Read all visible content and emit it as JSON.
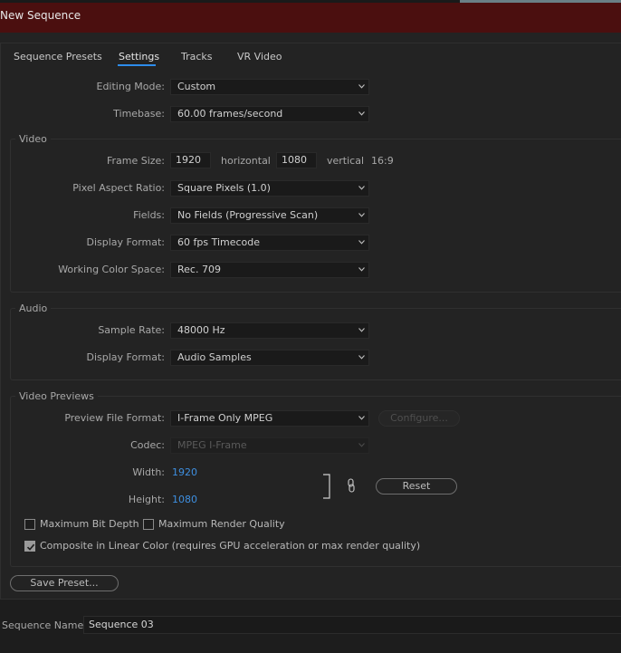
{
  "window": {
    "title": "New Sequence"
  },
  "tabs": [
    {
      "label": "Sequence Presets"
    },
    {
      "label": "Settings"
    },
    {
      "label": "Tracks"
    },
    {
      "label": "VR Video"
    }
  ],
  "settings": {
    "editing_mode": {
      "label": "Editing Mode:",
      "value": "Custom"
    },
    "timebase": {
      "label": "Timebase:",
      "value": "60.00  frames/second"
    }
  },
  "video": {
    "title": "Video",
    "frame_size": {
      "label": "Frame Size:",
      "width": "1920",
      "horizontal": "horizontal",
      "height": "1080",
      "vertical": "vertical",
      "aspect": "16:9"
    },
    "pixel_aspect": {
      "label": "Pixel Aspect Ratio:",
      "value": "Square Pixels (1.0)"
    },
    "fields": {
      "label": "Fields:",
      "value": "No Fields (Progressive Scan)"
    },
    "display_format": {
      "label": "Display Format:",
      "value": "60 fps Timecode"
    },
    "color_space": {
      "label": "Working Color Space:",
      "value": "Rec. 709"
    }
  },
  "audio": {
    "title": "Audio",
    "sample_rate": {
      "label": "Sample Rate:",
      "value": "48000 Hz"
    },
    "display_format": {
      "label": "Display Format:",
      "value": "Audio Samples"
    }
  },
  "previews": {
    "title": "Video Previews",
    "file_format": {
      "label": "Preview File Format:",
      "value": "I-Frame Only MPEG"
    },
    "configure_label": "Configure...",
    "codec": {
      "label": "Codec:",
      "value": "MPEG I-Frame"
    },
    "width": {
      "label": "Width:",
      "value": "1920"
    },
    "height": {
      "label": "Height:",
      "value": "1080"
    },
    "reset_label": "Reset",
    "max_bit_depth": {
      "label": "Maximum Bit Depth",
      "checked": false
    },
    "max_render_quality": {
      "label": "Maximum Render Quality",
      "checked": false
    },
    "linear_color": {
      "label": "Composite in Linear Color (requires GPU acceleration or max render quality)",
      "checked": true
    }
  },
  "save_preset_label": "Save Preset...",
  "sequence_name": {
    "label": "Sequence Name:",
    "value": "Sequence 03"
  },
  "colors": {
    "title_bar": "#4b0f0f",
    "accent": "#2d8ceb",
    "link": "#3e8fe0"
  },
  "icons": {
    "dropdown": "chevron-down-icon",
    "link": "chain-link-icon",
    "check": "checkmark-icon"
  }
}
